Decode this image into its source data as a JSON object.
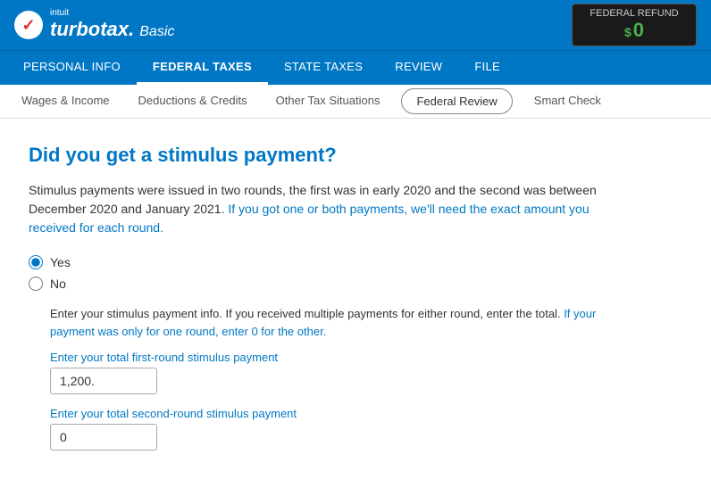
{
  "header": {
    "logo_intuit": "intuit",
    "logo_brand": "turbotax.",
    "logo_edition": "Basic",
    "refund_label": "Federal Refund",
    "refund_symbol": "$",
    "refund_amount": "0"
  },
  "top_nav": {
    "items": [
      {
        "id": "personal-info",
        "label": "PERSONAL INFO",
        "active": false
      },
      {
        "id": "federal-taxes",
        "label": "FEDERAL TAXES",
        "active": true
      },
      {
        "id": "state-taxes",
        "label": "STATE TAXES",
        "active": false
      },
      {
        "id": "review",
        "label": "REVIEW",
        "active": false
      },
      {
        "id": "file",
        "label": "FILE",
        "active": false
      }
    ]
  },
  "sub_nav": {
    "items": [
      {
        "id": "wages-income",
        "label": "Wages & Income",
        "active": false,
        "pill": false
      },
      {
        "id": "deductions-credits",
        "label": "Deductions & Credits",
        "active": false,
        "pill": false
      },
      {
        "id": "other-tax-situations",
        "label": "Other Tax Situations",
        "active": false,
        "pill": false
      },
      {
        "id": "federal-review",
        "label": "Federal Review",
        "active": true,
        "pill": true
      },
      {
        "id": "smart-check",
        "label": "Smart Check",
        "active": false,
        "pill": false
      }
    ]
  },
  "main": {
    "page_title": "Did you get a stimulus payment?",
    "description_p1": "Stimulus payments were issued in two rounds, the first was in early 2020 and the second was between December 2020 and January 2021.",
    "description_p2": " If you got one or both payments, we'll need the exact amount you received for each round.",
    "radio_yes": "Yes",
    "radio_no": "No",
    "stimulus_info_p1": "Enter your stimulus payment info. If you received multiple payments for either round, enter the total.",
    "stimulus_info_link": " If your payment was only for one round, enter 0 for the other.",
    "label_first_round": "Enter your total first-round stimulus payment",
    "label_second_round": "Enter your total second-round stimulus payment",
    "first_round_value": "1,200.",
    "second_round_value": "0"
  }
}
